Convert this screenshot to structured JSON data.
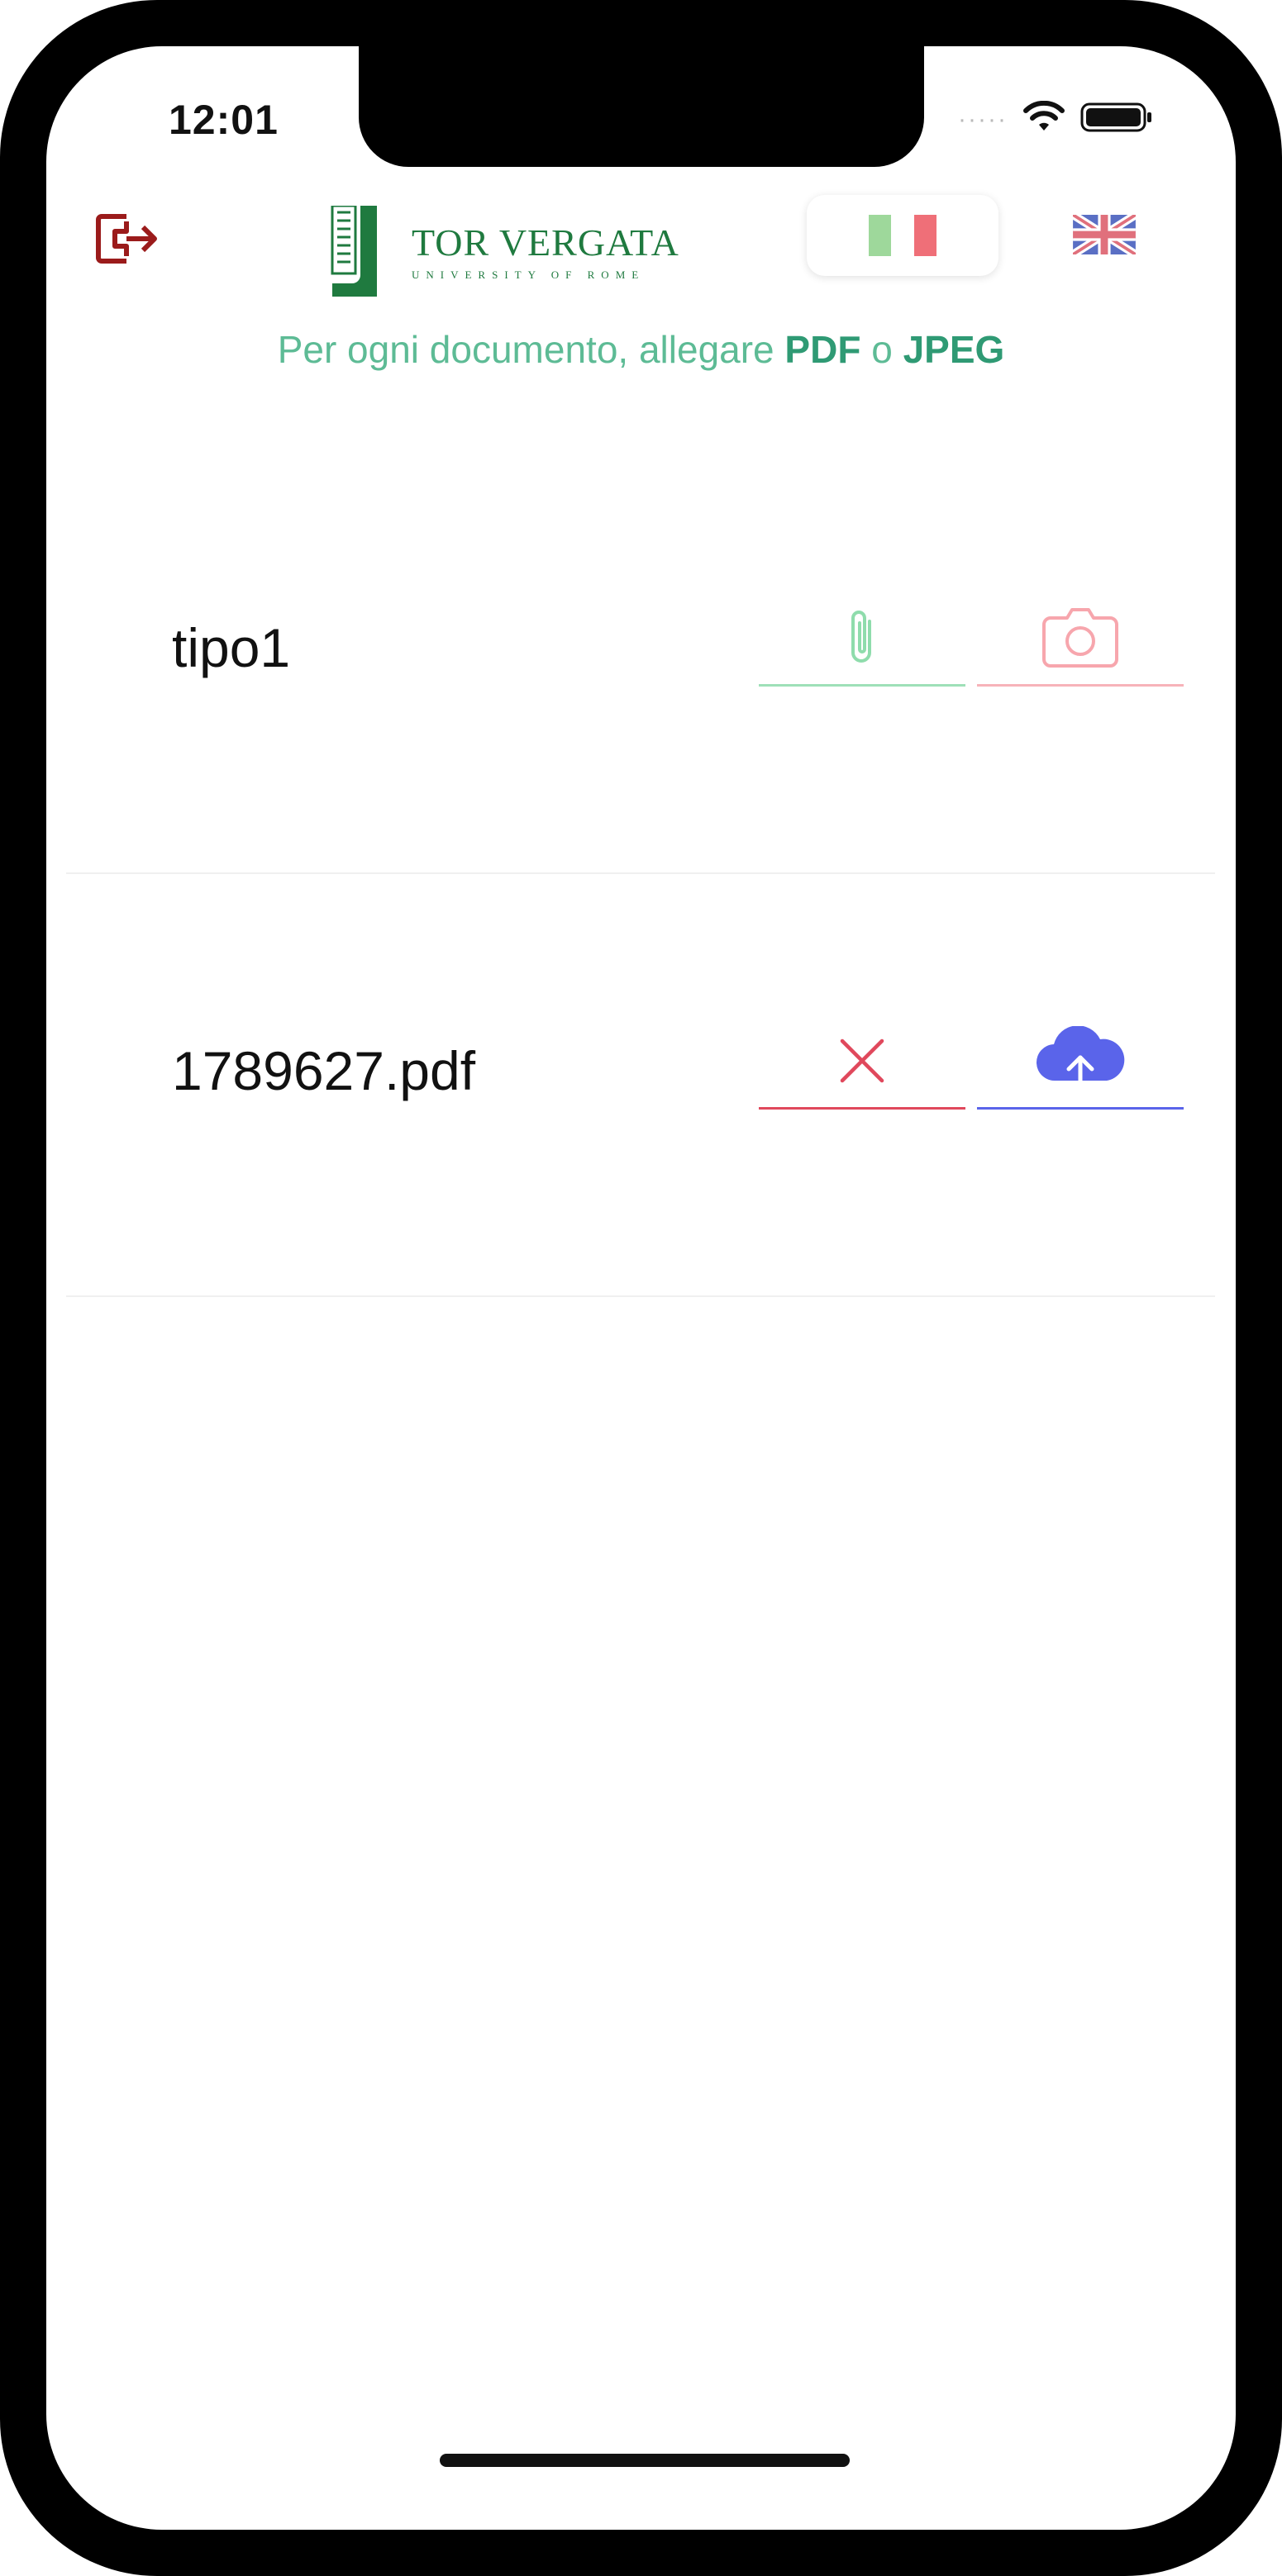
{
  "status_bar": {
    "time": "12:01",
    "signal_dots": "·····",
    "icons": [
      "wifi-icon",
      "battery-icon"
    ]
  },
  "header": {
    "logout_icon": "logout-icon",
    "logo": {
      "title": "TOR VERGATA",
      "subtitle": "UNIVERSITY OF ROME"
    },
    "languages": [
      {
        "code": "it",
        "icon": "italy-flag-icon",
        "selected": true
      },
      {
        "code": "en",
        "icon": "uk-flag-icon",
        "selected": false
      }
    ]
  },
  "hint": {
    "prefix": "Per ogni documento, allegare ",
    "pdf": "PDF",
    "middle": " o ",
    "jpeg": "JPEG"
  },
  "documents": [
    {
      "label": "tipo1",
      "actions": [
        {
          "icon": "paperclip-icon",
          "color": "#8fdcac"
        },
        {
          "icon": "camera-icon",
          "color": "#f7a6ad"
        }
      ]
    },
    {
      "label": "1789627.pdf",
      "actions": [
        {
          "icon": "close-icon",
          "color": "#e0485c"
        },
        {
          "icon": "cloud-upload-icon",
          "color": "#5a64ea"
        }
      ]
    }
  ],
  "colors": {
    "logout": "#9b1b1b",
    "brand_green": "#1f7a3f",
    "hint": "#5dbb95",
    "hint_bold": "#2f9a74"
  }
}
